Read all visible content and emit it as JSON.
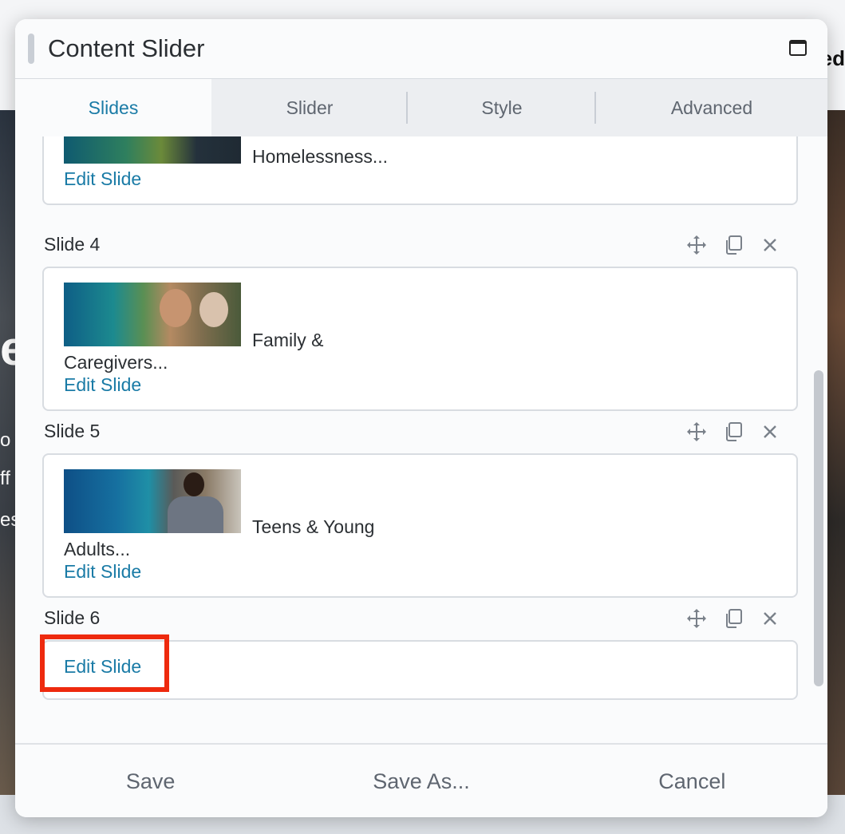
{
  "background": {
    "peek_right": "ed",
    "peek_left": [
      "e",
      "o",
      "ff",
      "es"
    ]
  },
  "modal": {
    "title": "Content Slider"
  },
  "tabs": [
    {
      "label": "Slides",
      "active": true
    },
    {
      "label": "Slider",
      "active": false
    },
    {
      "label": "Style",
      "active": false
    },
    {
      "label": "Advanced",
      "active": false
    }
  ],
  "slides": {
    "slide3": {
      "title": "Homelessness...",
      "edit": "Edit Slide"
    },
    "slide4": {
      "label": "Slide 4",
      "title_line1": "Family &",
      "title_line2": "Caregivers...",
      "edit": "Edit Slide"
    },
    "slide5": {
      "label": "Slide 5",
      "title_line1": "Teens & Young",
      "title_line2": "Adults...",
      "edit": "Edit Slide"
    },
    "slide6": {
      "label": "Slide 6",
      "edit": "Edit Slide"
    }
  },
  "icons": {
    "move": "move-arrows-icon",
    "duplicate": "copy-icon",
    "remove": "close-icon",
    "maximize": "window-maximize-icon"
  },
  "footer": {
    "save": "Save",
    "save_as": "Save As...",
    "cancel": "Cancel"
  },
  "colors": {
    "accent": "#1a7ba6",
    "highlight": "#ee2a0e"
  }
}
